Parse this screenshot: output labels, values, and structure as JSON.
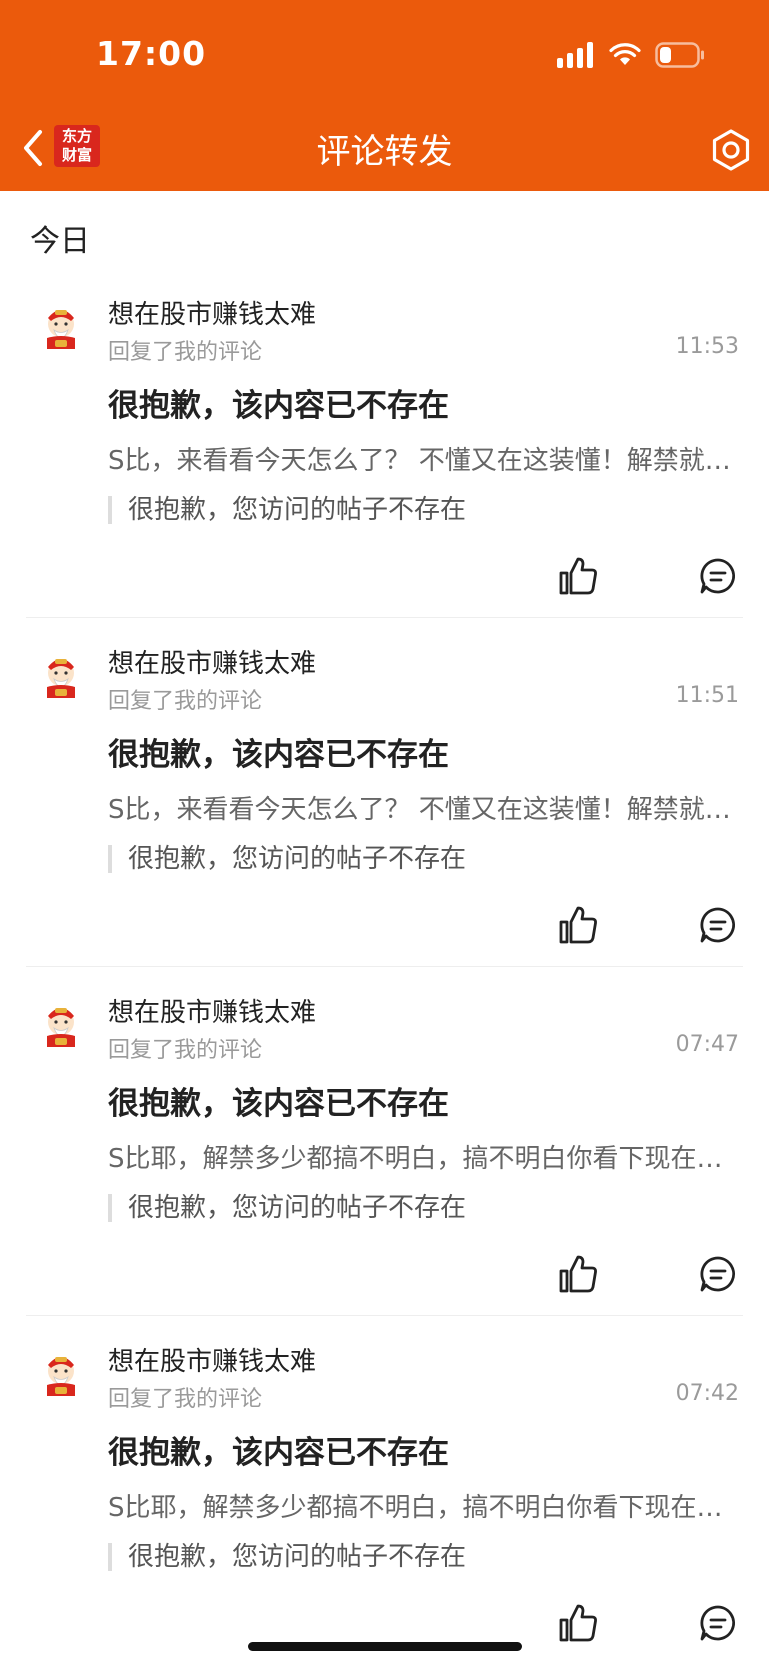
{
  "status_bar": {
    "time": "17:00"
  },
  "nav": {
    "title": "评论转发",
    "logo_line1": "东方",
    "logo_line2": "财富"
  },
  "section": {
    "label": "今日"
  },
  "colors": {
    "brand": "#eb5a0c",
    "logo": "#d9271d"
  },
  "icons": [
    "back-icon",
    "logo",
    "settings-icon",
    "signal-icon",
    "wifi-icon",
    "battery-icon",
    "like-icon",
    "comment-icon"
  ],
  "items": [
    {
      "user": "想在股市赚钱太难",
      "action": "回复了我的评论",
      "time": "11:53",
      "headline": "很抱歉，该内容已不存在",
      "body": "S比，来看看今天怎么了？  不懂又在这装懂！解禁就是影响",
      "quote": "很抱歉，您访问的帖子不存在"
    },
    {
      "user": "想在股市赚钱太难",
      "action": "回复了我的评论",
      "time": "11:51",
      "headline": "很抱歉，该内容已不存在",
      "body": "S比，来看看今天怎么了？  不懂又在这装懂！解禁就是影响",
      "quote": "很抱歉，您访问的帖子不存在"
    },
    {
      "user": "想在股市赚钱太难",
      "action": "回复了我的评论",
      "time": "07:47",
      "headline": "很抱歉，该内容已不存在",
      "body": "S比耶，解禁多少都搞不明白，搞不明白你看下现在的行情",
      "quote": "很抱歉，您访问的帖子不存在"
    },
    {
      "user": "想在股市赚钱太难",
      "action": "回复了我的评论",
      "time": "07:42",
      "headline": "很抱歉，该内容已不存在",
      "body": "S比耶，解禁多少都搞不明白，搞不明白你看下现在的行情",
      "quote": "很抱歉，您访问的帖子不存在"
    }
  ]
}
